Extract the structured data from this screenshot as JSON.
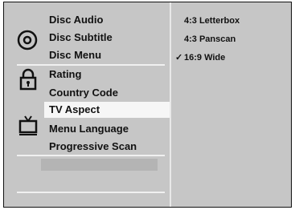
{
  "menu": {
    "groups": [
      {
        "icon": "disc-icon",
        "items": [
          "Disc Audio",
          "Disc Subtitle",
          "Disc Menu"
        ]
      },
      {
        "icon": "lock-icon",
        "items": [
          "Rating",
          "Country Code"
        ]
      },
      {
        "icon": "tv-icon",
        "items": [
          "TV Aspect",
          "Menu Language",
          "Progressive Scan"
        ]
      }
    ],
    "selected": "TV Aspect"
  },
  "options": {
    "items": [
      "4:3 Letterbox",
      "4:3 Panscan",
      "16:9 Wide"
    ],
    "checked_index": 2,
    "check_mark": "✓"
  }
}
